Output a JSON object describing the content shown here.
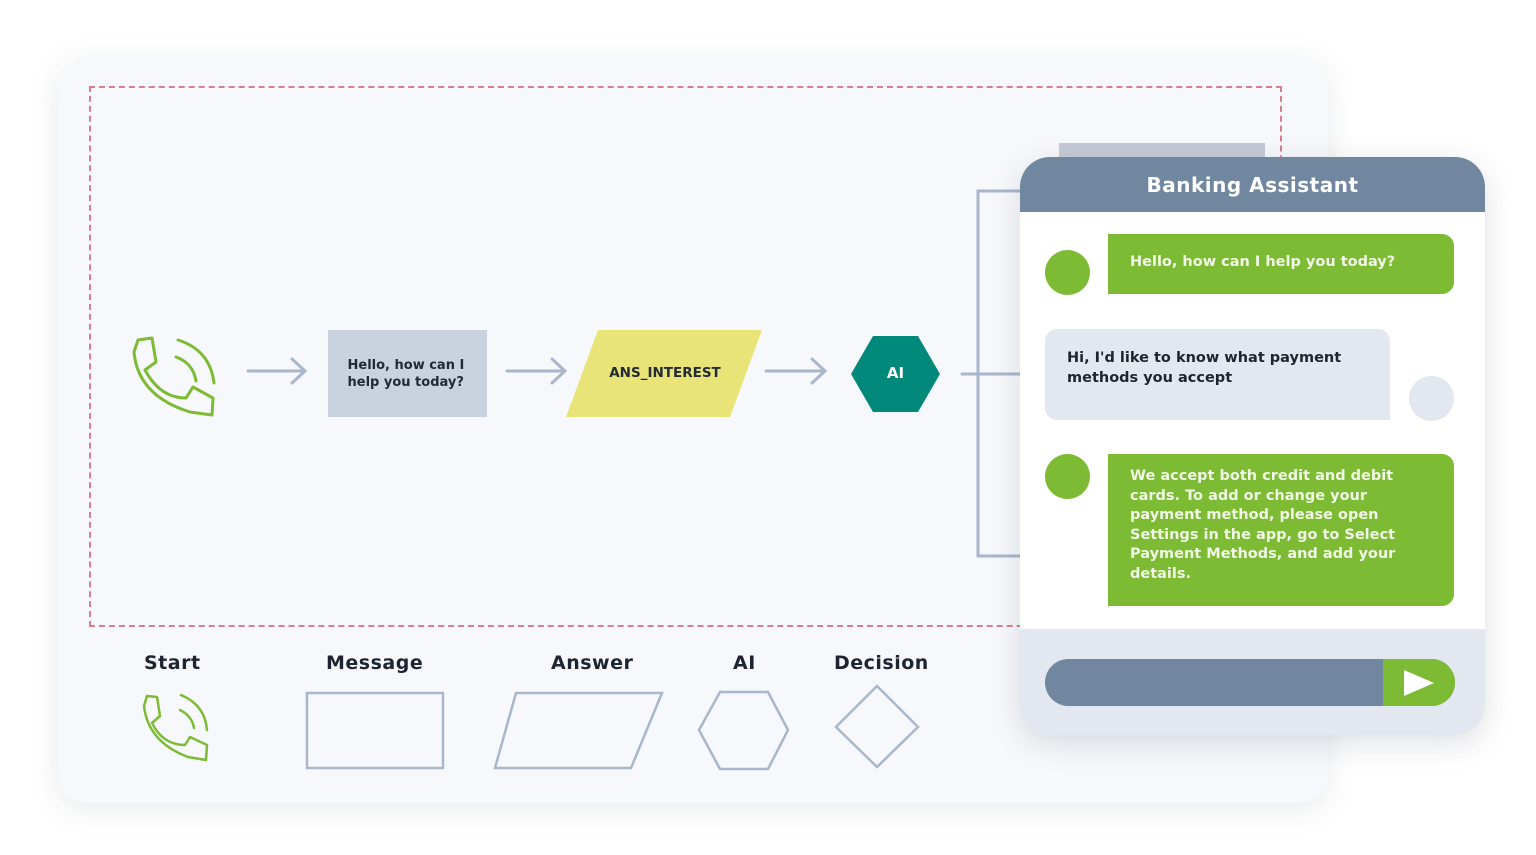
{
  "flow": {
    "start_icon": "phone-icon",
    "message_node": {
      "label": "Hello, how can I help you today?"
    },
    "answer_node": {
      "label": "ANS_INTEREST"
    },
    "ai_node": {
      "label": "AI"
    }
  },
  "legend": {
    "items": [
      {
        "label": "Start",
        "shape": "phone-icon"
      },
      {
        "label": "Message",
        "shape": "rectangle"
      },
      {
        "label": "Answer",
        "shape": "parallelogram"
      },
      {
        "label": "AI",
        "shape": "hexagon"
      },
      {
        "label": "Decision",
        "shape": "diamond"
      }
    ]
  },
  "chat": {
    "title": "Banking Assistant",
    "messages": [
      {
        "role": "bot",
        "text": "Hello, how can I help you today?"
      },
      {
        "role": "user",
        "text": "Hi, I'd like to know what payment methods you accept"
      },
      {
        "role": "bot",
        "text": "We accept both credit and debit cards. To add or change your payment method, please open Settings in the app, go to Select Payment Methods, and add your details."
      }
    ],
    "input_placeholder": "",
    "send_icon": "send-icon"
  },
  "colors": {
    "green": "#7dbb34",
    "slate": "#71869f",
    "teal": "#00897b",
    "yellow": "#e8e477",
    "message_fill": "#c9d3df",
    "connector": "#a9b6cc",
    "dashed_border": "#d77f8e"
  }
}
